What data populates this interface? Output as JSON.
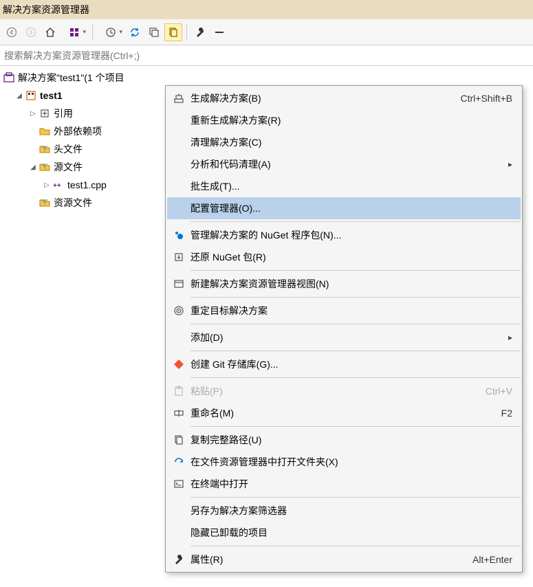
{
  "title": "解决方案资源管理器",
  "search": {
    "placeholder": "搜索解决方案资源管理器(Ctrl+;)"
  },
  "tree": {
    "solution": "解决方案\"test1\"(1 个项目",
    "project": "test1",
    "references": "引用",
    "external": "外部依赖项",
    "headers": "头文件",
    "sources": "源文件",
    "sourcefile": "test1.cpp",
    "resources": "资源文件"
  },
  "menu": {
    "build": "生成解决方案(B)",
    "build_sc": "Ctrl+Shift+B",
    "rebuild": "重新生成解决方案(R)",
    "clean": "清理解决方案(C)",
    "analyze": "分析和代码清理(A)",
    "batch": "批生成(T)...",
    "config": "配置管理器(O)...",
    "nuget": "管理解决方案的 NuGet 程序包(N)...",
    "restore": "还原 NuGet 包(R)",
    "newview": "新建解决方案资源管理器视图(N)",
    "retarget": "重定目标解决方案",
    "add": "添加(D)",
    "git": "创建 Git 存储库(G)...",
    "paste": "粘贴(P)",
    "paste_sc": "Ctrl+V",
    "rename": "重命名(M)",
    "rename_sc": "F2",
    "copypath": "复制完整路径(U)",
    "openfolder": "在文件资源管理器中打开文件夹(X)",
    "terminal": "在终端中打开",
    "savefilter": "另存为解决方案筛选器",
    "hide": "隐藏已卸载的项目",
    "properties": "属性(R)",
    "properties_sc": "Alt+Enter"
  },
  "watermark": ""
}
